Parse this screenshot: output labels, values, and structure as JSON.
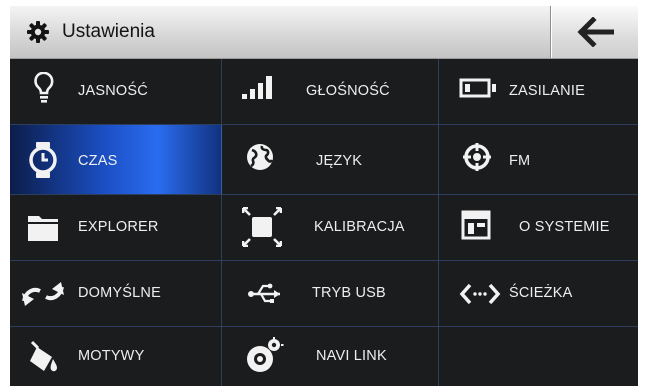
{
  "header": {
    "title": "Ustawienia",
    "title_icon": "gear-icon",
    "back_icon": "arrow-left-icon"
  },
  "colors": {
    "background": "#1c1d1f",
    "selected_tile": "#2a6cf0",
    "grid_lines": "#2d3f5c",
    "header_bg": "#d8d8d8"
  },
  "menu": {
    "jasnosc": {
      "label": "JASNOŚĆ",
      "icon": "lightbulb-icon"
    },
    "glosnosc": {
      "label": "GŁOŚNOŚĆ",
      "icon": "volume-bars-icon"
    },
    "zasilanie": {
      "label": "ZASILANIE",
      "icon": "battery-icon"
    },
    "czas": {
      "label": "CZAS",
      "icon": "watch-icon",
      "selected": true
    },
    "jezyk": {
      "label": "JĘZYK",
      "icon": "globe-icon"
    },
    "fm": {
      "label": "FM",
      "icon": "fm-radio-icon"
    },
    "explorer": {
      "label": "EXPLORER",
      "icon": "folder-icon"
    },
    "kalibracja": {
      "label": "KALIBRACJA",
      "icon": "calibration-icon"
    },
    "o_systemie": {
      "label": "O SYSTEMIE",
      "icon": "system-layout-icon"
    },
    "domyslne": {
      "label": "DOMYŚLNE",
      "icon": "reset-arrows-icon"
    },
    "tryb_usb": {
      "label": "TRYB USB",
      "icon": "usb-icon"
    },
    "sciezka": {
      "label": "ŚCIEŻKA",
      "icon": "path-arrows-icon"
    },
    "motywy": {
      "label": "MOTYWY",
      "icon": "paint-bucket-icon"
    },
    "navi_link": {
      "label": "NAVI LINK",
      "icon": "navi-link-icon"
    }
  }
}
